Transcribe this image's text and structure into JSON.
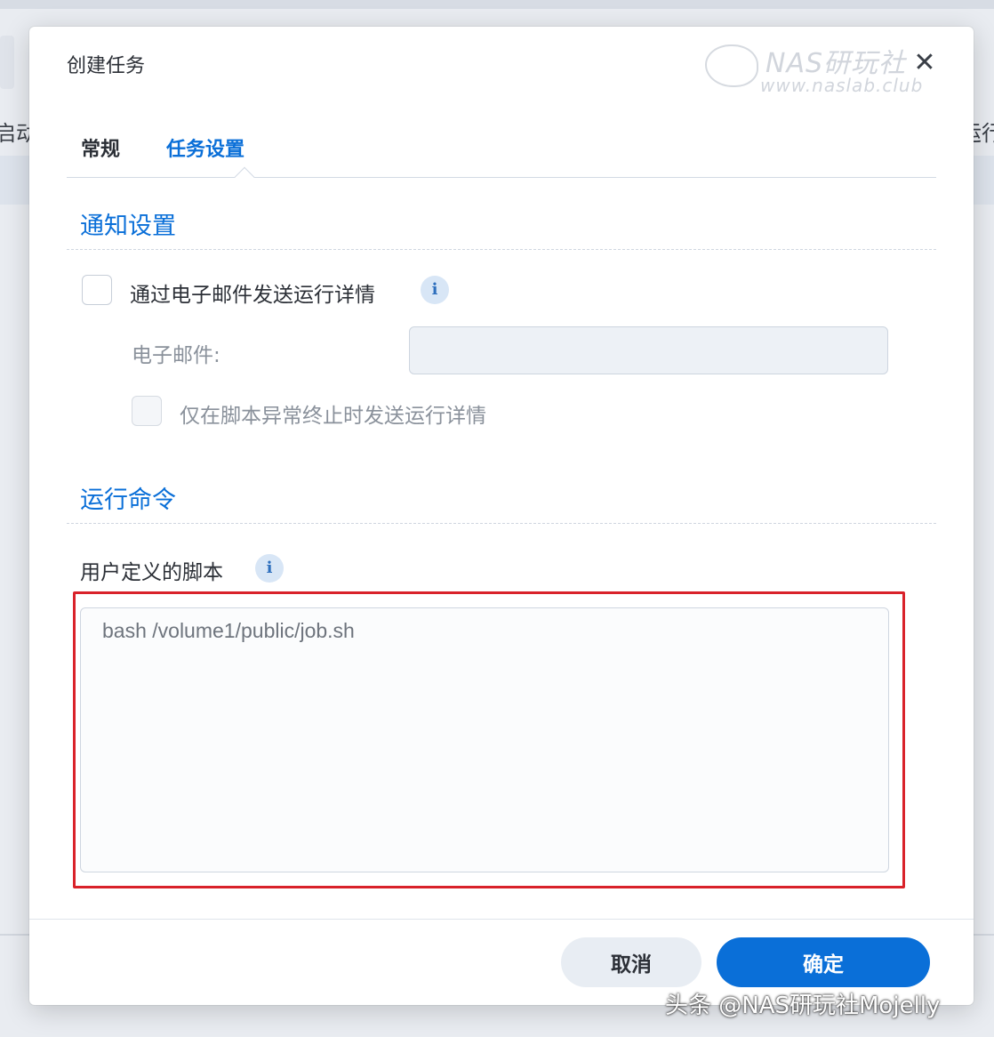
{
  "background": {
    "left_text": "启动",
    "right_text": "运行"
  },
  "dialog": {
    "title": "创建任务",
    "close_glyph": "✕",
    "watermark_main": "NAS研玩社",
    "watermark_url": "www.naslab.club"
  },
  "tabs": [
    {
      "label": "常规",
      "active": false
    },
    {
      "label": "任务设置",
      "active": true
    }
  ],
  "notify": {
    "section_title": "通知设置",
    "send_email_label": "通过电子邮件发送运行详情",
    "send_email_checked": false,
    "email_label": "电子邮件:",
    "email_value": "",
    "only_abnormal_label": "仅在脚本异常终止时发送运行详情",
    "only_abnormal_checked": false
  },
  "run": {
    "section_title": "运行命令",
    "script_label": "用户定义的脚本",
    "script_value": "bash /volume1/public/job.sh"
  },
  "info_glyph": "i",
  "buttons": {
    "cancel": "取消",
    "ok": "确定"
  },
  "overlay_watermark": "头条 @NAS研玩社Mojelly",
  "colors": {
    "accent": "#0a6fd8",
    "highlight": "#d9222a"
  }
}
